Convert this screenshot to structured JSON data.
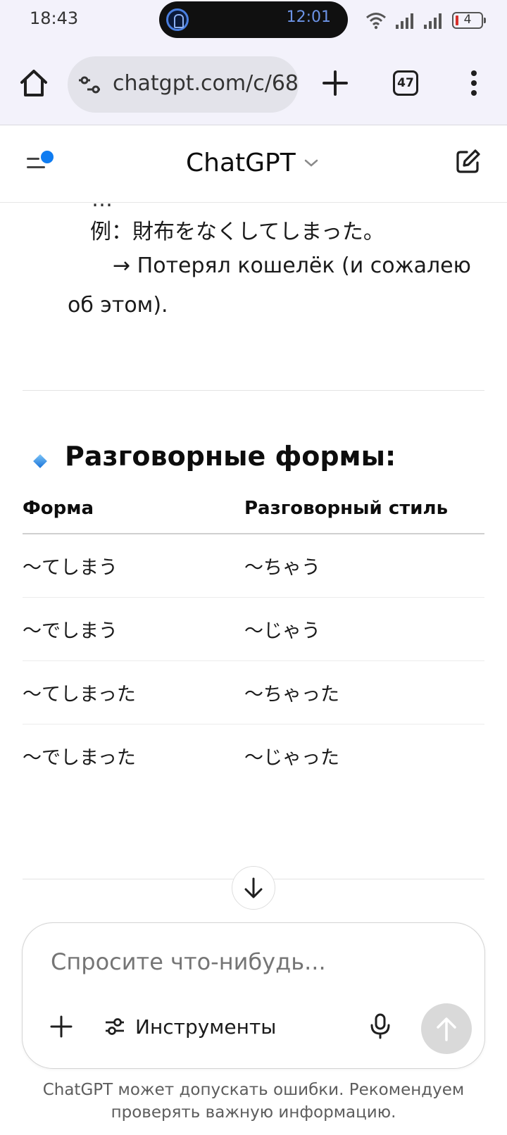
{
  "status_bar": {
    "time": "18:43",
    "pill_time": "12:01",
    "battery": "4"
  },
  "browser": {
    "url": "chatgpt.com/c/68",
    "tab_count": "47"
  },
  "header": {
    "title": "ChatGPT"
  },
  "content": {
    "cut_line": "…",
    "example": "例：財布をなくしてしまった。",
    "translation_1": "→ Потерял кошелёк (и сожалею",
    "translation_2": "об этом).",
    "section_title": "Разговорные формы:",
    "table": {
      "headers": [
        "Форма",
        "Разговорный стиль"
      ],
      "rows": [
        [
          "〜てしまう",
          "〜ちゃう"
        ],
        [
          "〜でしまう",
          "〜じゃう"
        ],
        [
          "〜てしまった",
          "〜ちゃった"
        ],
        [
          "〜でしまった",
          "〜じゃった"
        ]
      ]
    }
  },
  "composer": {
    "placeholder": "Спросите что-нибудь...",
    "tools_label": "Инструменты"
  },
  "footer": {
    "note": "ChatGPT может допускать ошибки. Рекомендуем проверять важную информацию."
  },
  "colors": {
    "accent": "#0f7cf1",
    "browser_bg": "#f3f2fb",
    "send_disabled": "#d9d9d9"
  }
}
